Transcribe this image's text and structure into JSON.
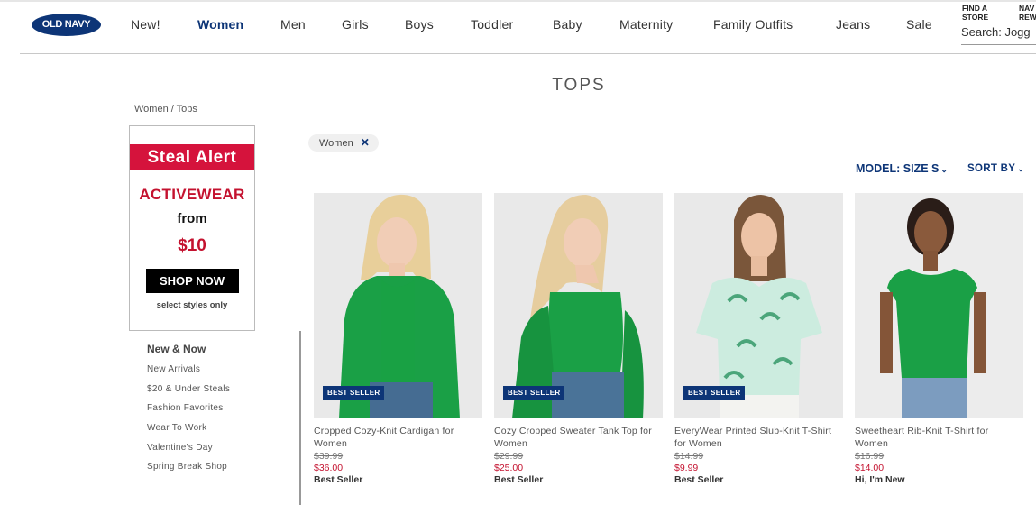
{
  "header": {
    "logo_text": "OLD NAVY",
    "nav": [
      "New!",
      "Women",
      "Men",
      "Girls",
      "Boys",
      "Toddler",
      "Baby",
      "Maternity",
      "Family Outfits",
      "Jeans",
      "Sale"
    ],
    "active_nav": "Women",
    "find_store": "FIND A\nSTORE",
    "rewards": "NAV\nREW",
    "search_label": "Search:",
    "search_value": "Jogg"
  },
  "page": {
    "title": "TOPS",
    "breadcrumb": "Women / Tops"
  },
  "promo": {
    "banner": "Steal Alert",
    "line1": "ACTIVEWEAR",
    "line2": "from",
    "price": "$10",
    "cta": "SHOP NOW",
    "note": "select styles only"
  },
  "sidebar": {
    "heading": "New & Now",
    "items": [
      "New Arrivals",
      "$20 & Under Steals",
      "Fashion Favorites",
      "Wear To Work",
      "Valentine's Day",
      "Spring Break Shop"
    ]
  },
  "filters": {
    "chip": "Women",
    "chip_close": "✕"
  },
  "controls": {
    "model_label": "MODEL:",
    "model_value": "SIZE S",
    "sort_label": "SORT BY"
  },
  "products": [
    {
      "name": "Cropped Cozy-Knit Cardigan for Women",
      "was": "$39.99",
      "now": "$36.00",
      "tag": "Best Seller",
      "badge": "BEST SELLER",
      "image": "model-green-cardigan"
    },
    {
      "name": "Cozy Cropped Sweater Tank Top for Women",
      "was": "$29.99",
      "now": "$25.00",
      "tag": "Best Seller",
      "badge": "BEST SELLER",
      "image": "model-green-tank"
    },
    {
      "name": "EveryWear Printed Slub-Knit T-Shirt for Women",
      "was": "$14.99",
      "now": "$9.99",
      "tag": "Best Seller",
      "badge": "BEST SELLER",
      "image": "model-palm-print-tee"
    },
    {
      "name": "Sweetheart Rib-Knit T-Shirt for Women",
      "was": "$16.99",
      "now": "$14.00",
      "tag": "Hi, I'm New",
      "badge": "",
      "image": "model-green-tee"
    }
  ],
  "colors": {
    "brand_navy": "#0d3577",
    "sale_red": "#c4122f",
    "promo_red": "#d5133c",
    "garment_green": "#1aa046"
  }
}
